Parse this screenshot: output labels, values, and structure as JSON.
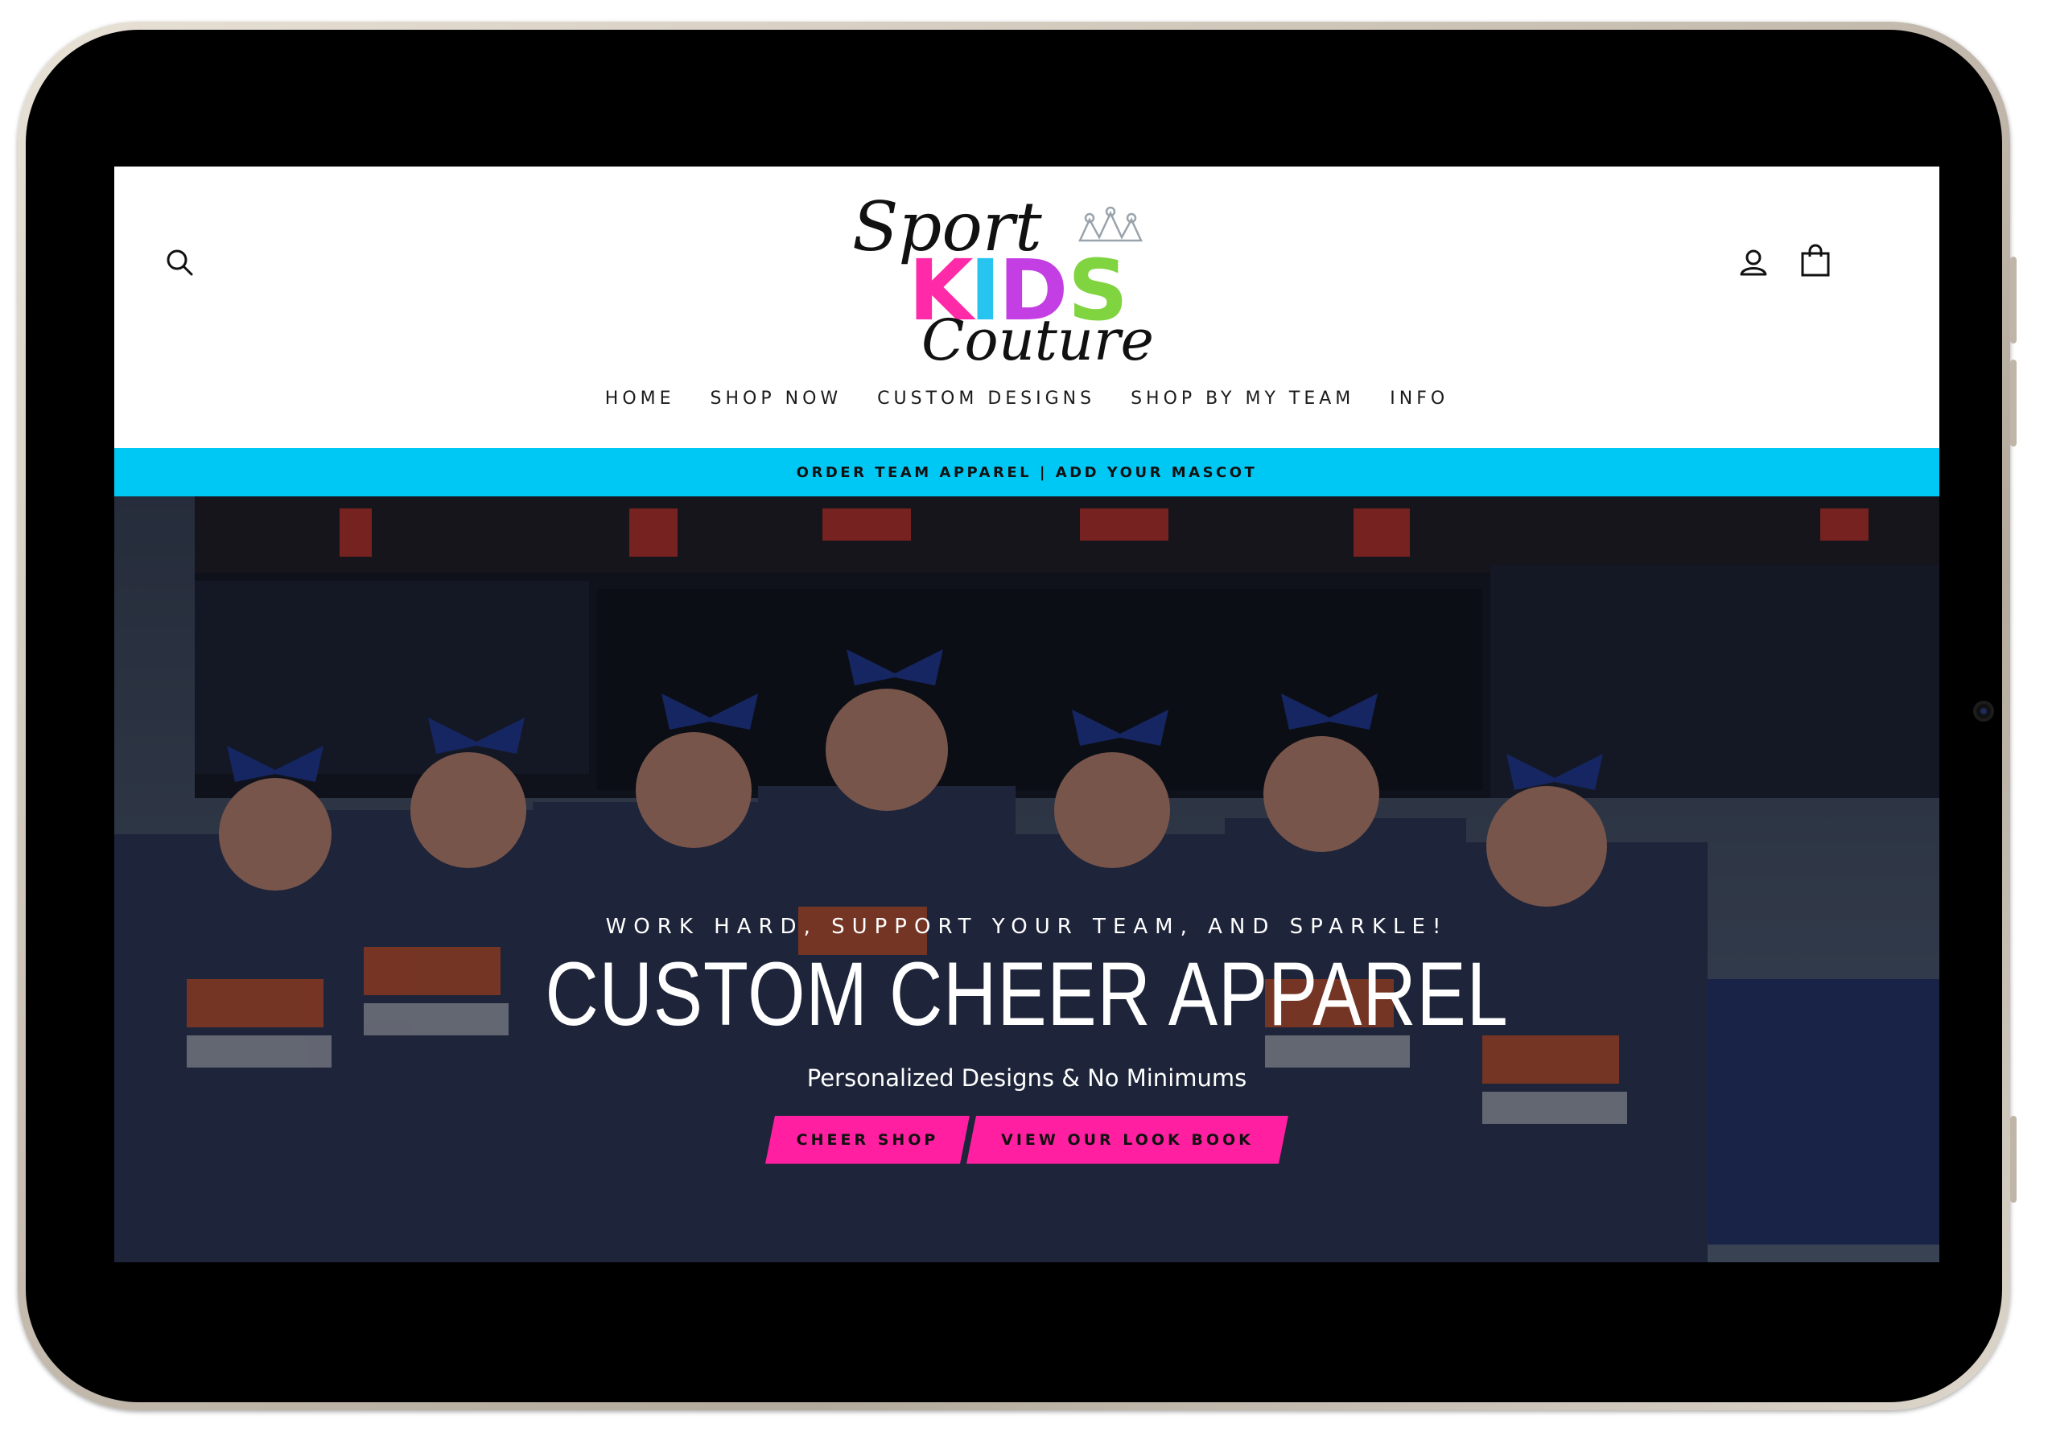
{
  "header": {
    "logo_text": [
      "Sport",
      "KIDS",
      "Couture"
    ],
    "nav": [
      "HOME",
      "SHOP NOW",
      "CUSTOM DESIGNS",
      "SHOP BY MY TEAM",
      "INFO"
    ],
    "icons": {
      "search": "search-icon",
      "account": "user-icon",
      "cart": "shopping-bag-icon"
    }
  },
  "announcement": {
    "text": "ORDER TEAM APPAREL | ADD YOUR MASCOT"
  },
  "hero": {
    "subheading": "WORK HARD, SUPPORT YOUR TEAM, AND SPARKLE!",
    "title": "CUSTOM CHEER APPAREL",
    "text": "Personalized Designs & No Minimums",
    "buttons": [
      "CHEER SHOP",
      "VIEW OUR LOOK BOOK"
    ]
  },
  "colors": {
    "announcement_bg": "#00c8f5",
    "button_bg": "#ff1fa0",
    "device_frame": "#c9c0b3",
    "bezel": "#000000"
  }
}
